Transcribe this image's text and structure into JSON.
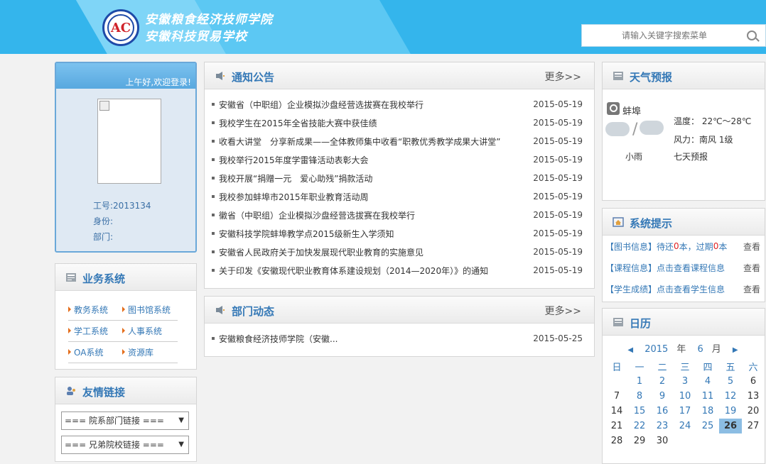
{
  "header": {
    "school_name_1": "安徽粮食经济技师学院",
    "school_name_2": "安徽科技贸易学校",
    "logo_mark": "安徽粮食经济技师学院",
    "search_placeholder": "请输入关键字搜索菜单"
  },
  "login": {
    "greeting": "上午好,欢迎登录!",
    "id_label": "工号:2013134",
    "role_label": "身份:",
    "dept_label": "部门:"
  },
  "business": {
    "title": "业务系统",
    "links": [
      "教务系统",
      "图书馆系统",
      "学工系统",
      "人事系统",
      "OA系统",
      "资源库"
    ]
  },
  "friends": {
    "title": "友情链接",
    "select1": "=== 院系部门链接 ===",
    "select2": "=== 兄弟院校链接 ==="
  },
  "notice": {
    "title": "通知公告",
    "more": "更多>>",
    "items": [
      {
        "title": "安徽省（中职组）企业模拟沙盘经营选拔赛在我校举行",
        "date": "2015-05-19"
      },
      {
        "title": "我校学生在2015年全省技能大赛中获佳绩",
        "date": "2015-05-19"
      },
      {
        "title": "收看大讲堂　分享新成果——全体教师集中收看“职教优秀教学成果大讲堂”",
        "date": "2015-05-19"
      },
      {
        "title": "我校举行2015年度学雷锋活动表彰大会",
        "date": "2015-05-19"
      },
      {
        "title": "我校开展“捐赠一元　爱心助残”捐款活动",
        "date": "2015-05-19"
      },
      {
        "title": "我校参加蚌埠市2015年职业教育活动周",
        "date": "2015-05-19"
      },
      {
        "title": "徽省（中职组）企业模拟沙盘经营选拔赛在我校举行",
        "date": "2015-05-19"
      },
      {
        "title": "安徽科技学院蚌埠教学点2015级新生入学须知",
        "date": "2015-05-19"
      },
      {
        "title": "安徽省人民政府关于加快发展现代职业教育的实施意见",
        "date": "2015-05-19"
      },
      {
        "title": "关于印发《安徽现代职业教育体系建设规划（2014—2020年）》的通知",
        "date": "2015-05-19"
      }
    ]
  },
  "dept": {
    "title": "部门动态",
    "more": "更多>>",
    "items": [
      {
        "title": "安徽粮食经济技师学院（安徽...",
        "date": "2015-05-25"
      }
    ]
  },
  "weather": {
    "title": "天气预报",
    "city": "蚌埠",
    "condition": "小雨",
    "temp": "温度： 22℃～28℃",
    "wind": "风力：南风 1级",
    "seven_day": "七天预报"
  },
  "tips": {
    "title": "系统提示",
    "lib_label": "【图书信息】",
    "lib_text1": "待还",
    "lib_due": "0",
    "lib_text2": "本，过期",
    "lib_over": "0",
    "lib_text3": "本",
    "course_label": "【课程信息】",
    "course_text": "点击查看课程信息",
    "grade_label": "【学生成绩】",
    "grade_text": "点击查看学生信息",
    "view": "查看"
  },
  "calendar": {
    "title": "日历",
    "year": "2015",
    "year_unit": "年",
    "month": "6",
    "month_unit": "月",
    "weekdays": [
      "日",
      "一",
      "二",
      "三",
      "四",
      "五",
      "六"
    ],
    "weeks": [
      [
        "",
        "1",
        "2",
        "3",
        "4",
        "5",
        "6"
      ],
      [
        "7",
        "8",
        "9",
        "10",
        "11",
        "12",
        "13"
      ],
      [
        "14",
        "15",
        "16",
        "17",
        "18",
        "19",
        "20"
      ],
      [
        "21",
        "22",
        "23",
        "24",
        "25",
        "26",
        "27"
      ],
      [
        "28",
        "29",
        "30",
        "",
        "",
        "",
        ""
      ]
    ],
    "today": "26"
  },
  "colors": {
    "accent": "#3478b6",
    "header": "#34b5ec",
    "highlight": "#8cbde3"
  }
}
